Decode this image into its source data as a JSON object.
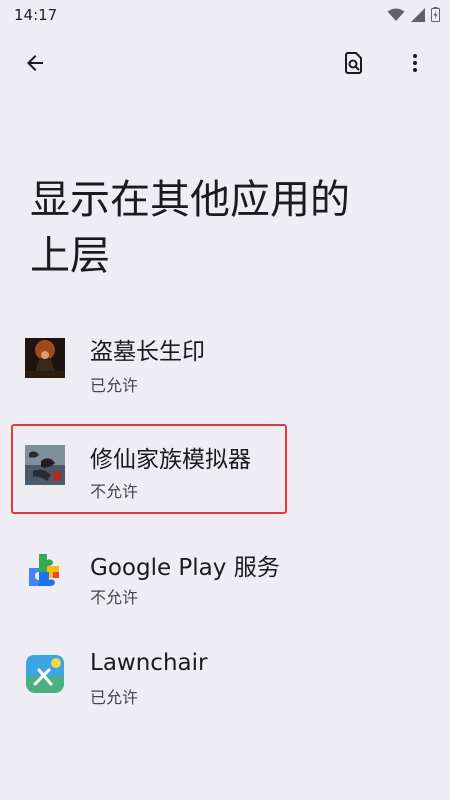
{
  "status_bar": {
    "time": "14:17",
    "icons": [
      "wifi-icon",
      "signal-icon",
      "battery-icon"
    ]
  },
  "toolbar": {
    "back_icon": "arrow-left-icon",
    "search_icon": "search-settings-icon",
    "more_icon": "more-vert-icon"
  },
  "page": {
    "title_line1": "显示在其他应用的",
    "title_line2": "上层"
  },
  "apps": [
    {
      "name": "盗墓长生印",
      "status": "已允许",
      "icon": "game-tomb-icon"
    },
    {
      "name": "修仙家族模拟器",
      "status": "不允许",
      "icon": "game-xiuxian-icon"
    },
    {
      "name": "Google Play 服务",
      "status": "不允许",
      "icon": "google-play-services-icon"
    },
    {
      "name": "Lawnchair",
      "status": "已允许",
      "icon": "lawnchair-icon"
    }
  ],
  "colors": {
    "background": "#eeedf3",
    "highlight_border": "#e03a3a",
    "primary_text": "#1b1b1f",
    "secondary_text": "#44464f"
  }
}
